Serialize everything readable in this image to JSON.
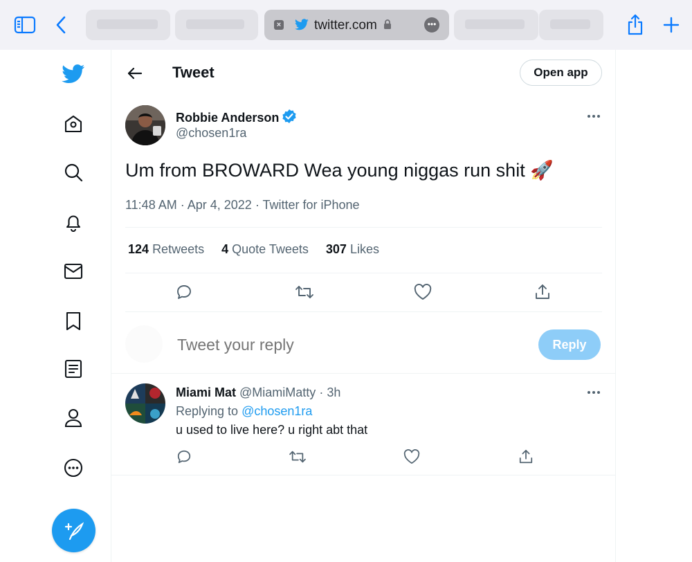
{
  "browser": {
    "url": "twitter.com",
    "colors": {
      "accent": "#0a7aff",
      "bar_bg": "#f2f2f7"
    }
  },
  "header": {
    "title": "Tweet",
    "open_app_label": "Open app"
  },
  "tweet": {
    "author_name": "Robbie Anderson",
    "author_handle": "@chosen1ra",
    "text": "Um from BROWARD Wea young niggas run shit 🚀",
    "time": "11:48 AM",
    "date": "Apr 4, 2022",
    "source": "Twitter for iPhone",
    "stats": {
      "retweets_count": "124",
      "retweets_label": "Retweets",
      "quotes_count": "4",
      "quotes_label": "Quote Tweets",
      "likes_count": "307",
      "likes_label": "Likes"
    }
  },
  "composer": {
    "placeholder": "Tweet your reply",
    "button_label": "Reply"
  },
  "replies": [
    {
      "author_name": "Miami Mat",
      "author_handle": "@MiamiMatty",
      "age": "3h",
      "replying_prefix": "Replying to",
      "replying_to": "@chosen1ra",
      "text": "u used to live here? u right abt that"
    }
  ],
  "colors": {
    "twitter_blue": "#1d9bf0",
    "reply_button_disabled": "#8ecdf8",
    "secondary_text": "#536471",
    "divider": "#eff3f4"
  },
  "icons": {
    "rail": [
      "twitter-bird-icon",
      "home-icon",
      "search-icon",
      "bell-icon",
      "mail-icon",
      "bookmark-icon",
      "lists-icon",
      "profile-icon",
      "more-circle-icon"
    ],
    "actions": [
      "reply-icon",
      "retweet-icon",
      "like-icon",
      "share-icon"
    ]
  }
}
